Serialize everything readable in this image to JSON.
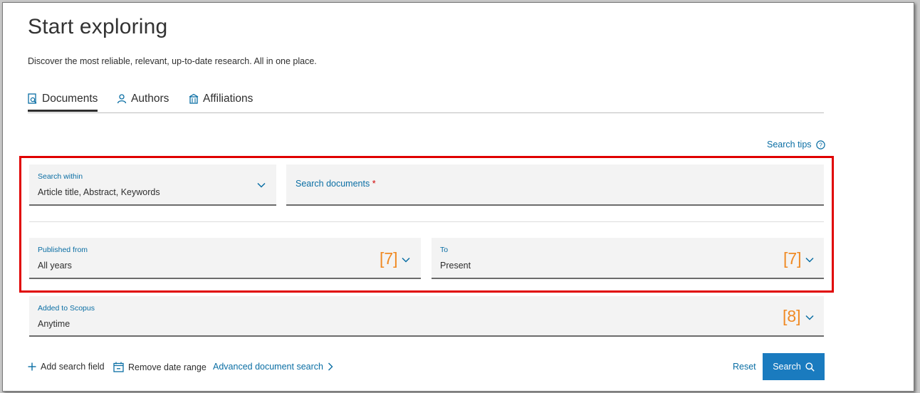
{
  "header": {
    "title": "Start exploring",
    "subtitle": "Discover the most reliable, relevant, up-to-date research. All in one place."
  },
  "tabs": [
    {
      "label": "Documents",
      "icon": "document-search-icon",
      "active": true
    },
    {
      "label": "Authors",
      "icon": "person-icon",
      "active": false
    },
    {
      "label": "Affiliations",
      "icon": "building-icon",
      "active": false
    }
  ],
  "search_tips": {
    "label": "Search tips",
    "icon": "help-circle-icon"
  },
  "form": {
    "search_within": {
      "label": "Search within",
      "value": "Article title, Abstract, Keywords"
    },
    "search_documents": {
      "label": "Search documents",
      "required_mark": "*"
    },
    "published_from": {
      "label": "Published from",
      "value": "All years",
      "marker": "[7]"
    },
    "to": {
      "label": "To",
      "value": "Present",
      "marker": "[7]"
    },
    "added_to_scopus": {
      "label": "Added to Scopus",
      "value": "Anytime",
      "marker": "[8]"
    }
  },
  "actions": {
    "add_field": "Add search field",
    "remove_date": "Remove date range",
    "advanced": "Advanced document search",
    "reset": "Reset",
    "search": "Search"
  },
  "colors": {
    "accent": "#0a6ea4",
    "button": "#1a7bbf",
    "highlight": "#e00000",
    "marker": "#f08a24",
    "field_bg": "#f3f3f3"
  }
}
